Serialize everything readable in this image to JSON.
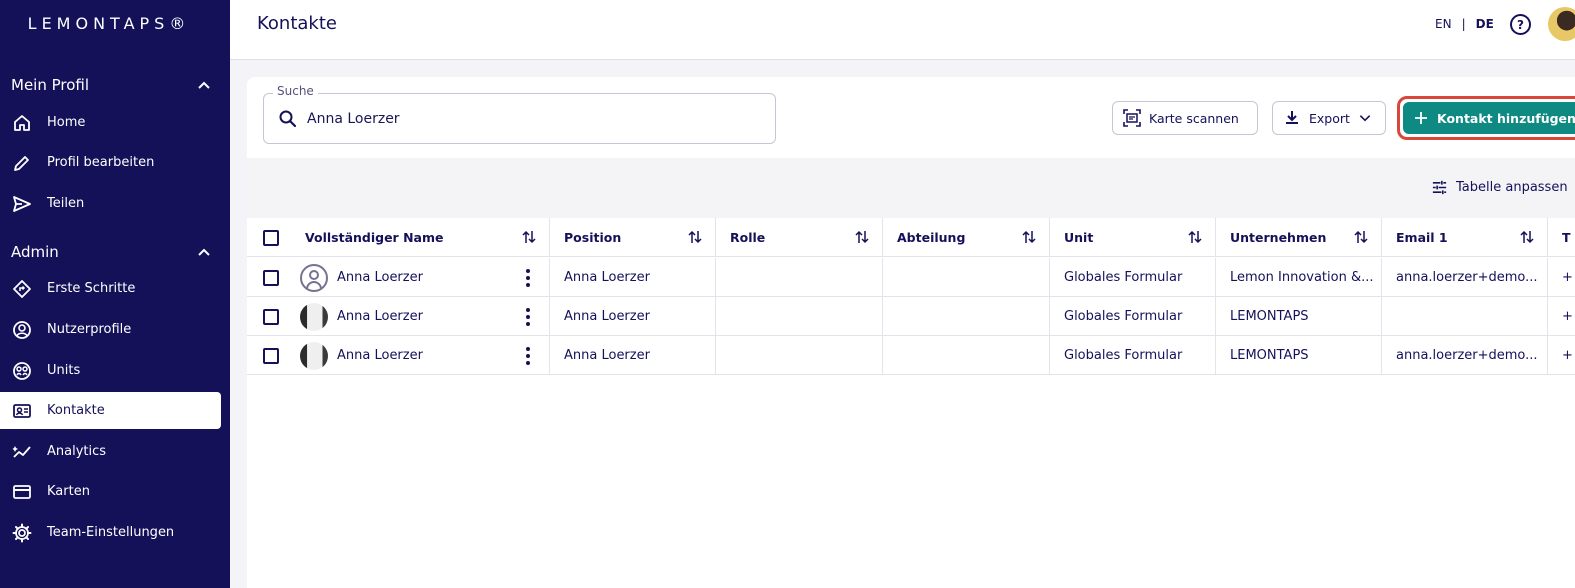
{
  "app": {
    "logo": "LEMONTAPS®"
  },
  "sidebar": {
    "sections": [
      {
        "title": "Mein Profil",
        "items": [
          {
            "label": "Home",
            "icon": "home-icon"
          },
          {
            "label": "Profil bearbeiten",
            "icon": "pencil-icon"
          },
          {
            "label": "Teilen",
            "icon": "send-icon"
          }
        ]
      },
      {
        "title": "Admin",
        "items": [
          {
            "label": "Erste Schritte",
            "icon": "directions-icon"
          },
          {
            "label": "Nutzerprofile",
            "icon": "user-circle-icon"
          },
          {
            "label": "Units",
            "icon": "units-icon"
          },
          {
            "label": "Kontakte",
            "icon": "contacts-icon",
            "active": true
          },
          {
            "label": "Analytics",
            "icon": "analytics-icon"
          },
          {
            "label": "Karten",
            "icon": "card-icon"
          },
          {
            "label": "Team-Einstellungen",
            "icon": "gear-icon"
          }
        ]
      }
    ]
  },
  "header": {
    "title": "Kontakte",
    "lang_en": "EN",
    "lang_sep": "|",
    "lang_de": "DE",
    "help": "?"
  },
  "search": {
    "label": "Suche",
    "value": "Anna Loerzer"
  },
  "actions": {
    "scan": "Karte scannen",
    "export": "Export",
    "add": "Kontakt hinzufügen",
    "customize": "Tabelle anpassen"
  },
  "table": {
    "columns": [
      "Vollständiger Name",
      "Position",
      "Rolle",
      "Abteilung",
      "Unit",
      "Unternehmen",
      "Email 1",
      "T"
    ],
    "rows": [
      {
        "name": "Anna Loerzer",
        "avatar": "default",
        "position": "Anna Loerzer",
        "rolle": "",
        "abteilung": "",
        "unit": "Globales Formular",
        "unternehmen": "Lemon Innovation &...",
        "email": "anna.loerzer+demo...",
        "extra": "+"
      },
      {
        "name": "Anna Loerzer",
        "avatar": "photo",
        "position": "Anna Loerzer",
        "rolle": "",
        "abteilung": "",
        "unit": "Globales Formular",
        "unternehmen": "LEMONTAPS",
        "email": "",
        "extra": "+"
      },
      {
        "name": "Anna Loerzer",
        "avatar": "photo",
        "position": "Anna Loerzer",
        "rolle": "",
        "abteilung": "",
        "unit": "Globales Formular",
        "unternehmen": "LEMONTAPS",
        "email": "anna.loerzer+demo...",
        "extra": "+"
      }
    ]
  },
  "colors": {
    "sidebar": "#141159",
    "accent": "#0e8a83",
    "highlight": "#d9473b"
  }
}
